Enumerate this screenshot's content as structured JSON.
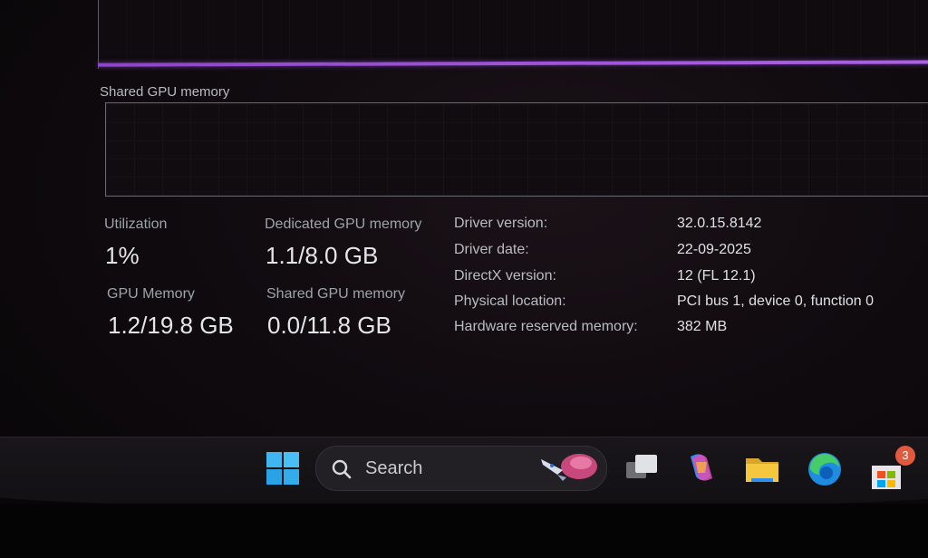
{
  "graphs": {
    "shared_title": "Shared GPU memory"
  },
  "stats": {
    "utilization_label": "Utilization",
    "utilization_value": "1%",
    "dedicated_label": "Dedicated GPU memory",
    "dedicated_value": "1.1/8.0 GB",
    "gpu_memory_label": "GPU Memory",
    "gpu_memory_value": "1.2/19.8 GB",
    "shared_label": "Shared GPU memory",
    "shared_value": "0.0/11.8 GB"
  },
  "info": [
    {
      "key": "Driver version:",
      "value": "32.0.15.8142"
    },
    {
      "key": "Driver date:",
      "value": "22-09-2025"
    },
    {
      "key": "DirectX version:",
      "value": "12 (FL 12.1)"
    },
    {
      "key": "Physical location:",
      "value": "PCI bus 1, device 0, function 0"
    },
    {
      "key": "Hardware reserved memory:",
      "value": "382 MB"
    }
  ],
  "taskbar": {
    "search_text": "Search",
    "store_badge": "3",
    "icons": [
      "windows-start-icon",
      "search-icon",
      "task-view-icon",
      "copilot-icon",
      "file-explorer-icon",
      "edge-icon",
      "microsoft-store-icon"
    ]
  },
  "colors": {
    "graph_line": "#8d46c8",
    "badge": "#e25a3d"
  }
}
